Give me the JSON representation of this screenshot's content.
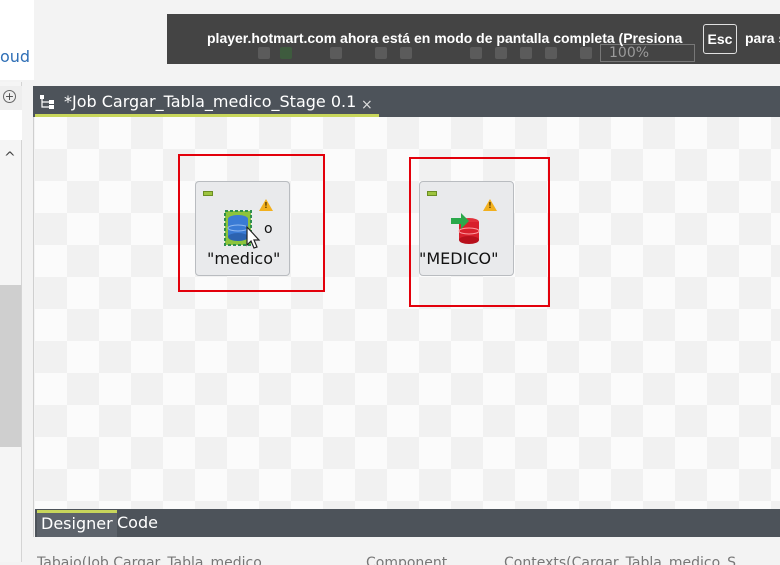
{
  "left_panel": {
    "cloud_text": "oud",
    "plus_icon": "plus-circle-icon",
    "chevron_icon": "chevron-up-icon"
  },
  "fullscreen_notice": {
    "message": "player.hotmart.com ahora está en modo de pantalla completa (Presiona",
    "key": "Esc",
    "message_tail": "para s"
  },
  "toolbar": {
    "zoom_value": "100%"
  },
  "editor": {
    "tab_title": "*Job Cargar_Tabla_medico_Stage 0.1",
    "tab_close": "×",
    "tab_icon": "job-icon"
  },
  "components": [
    {
      "label": "\"medico\"",
      "icon": "database-input-icon",
      "warning_icon": "warning-icon",
      "overlay_text": "o"
    },
    {
      "label": "\"MEDICO\"",
      "icon": "database-output-icon",
      "warning_icon": "warning-icon"
    }
  ],
  "bottom_tabs": [
    {
      "label": "Designer",
      "active": true
    },
    {
      "label": "Code",
      "active": false
    }
  ],
  "status_items": [
    "Tabajo(Job Cargar_Tabla_medico...",
    "Component",
    "Contexts(Cargar_Tabla_medico_S..."
  ],
  "colors": {
    "tab_bar": "#4d535a",
    "tab_accent": "#c8d65b",
    "highlight_box": "#e3000b",
    "link_blue": "#2f6fb6"
  }
}
